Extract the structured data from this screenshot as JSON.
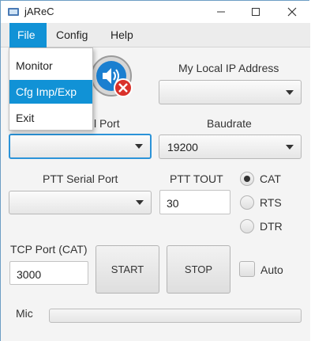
{
  "window": {
    "title": "jAReC",
    "controls": {
      "minimize": "—",
      "maximize": "☐",
      "close": "✕"
    }
  },
  "menu": {
    "items": [
      {
        "label": "File"
      },
      {
        "label": "Config"
      },
      {
        "label": "Help"
      }
    ],
    "file_dropdown": [
      {
        "label": "Monitor"
      },
      {
        "label": "Cfg Imp/Exp"
      },
      {
        "label": "Exit"
      }
    ]
  },
  "network": {
    "local_ip_label": "My Local IP Address",
    "local_ip_value": ""
  },
  "serial": {
    "port_label_partial": "l Port",
    "port_value": "",
    "baudrate_label": "Baudrate",
    "baudrate_value": "19200"
  },
  "ptt": {
    "serial_port_label": "PTT Serial Port",
    "serial_port_value": "",
    "tout_label": "PTT TOUT",
    "tout_value": "30",
    "modes": [
      {
        "label": "CAT",
        "checked": true
      },
      {
        "label": "RTS",
        "checked": false
      },
      {
        "label": "DTR",
        "checked": false
      }
    ]
  },
  "tcp": {
    "port_label": "TCP Port (CAT)",
    "port_value": "3000"
  },
  "buttons": {
    "start": "START",
    "stop": "STOP"
  },
  "auto": {
    "label": "Auto",
    "checked": false
  },
  "mic": {
    "label": "Mic",
    "level": 0
  },
  "colors": {
    "accent": "#1192d6",
    "focus_border": "#2b93d8",
    "mute_badge": "#d9312b",
    "speaker_blue": "#1a7fd0"
  },
  "icons": {
    "app": "app-icon",
    "speaker": "speaker-muted-icon"
  }
}
